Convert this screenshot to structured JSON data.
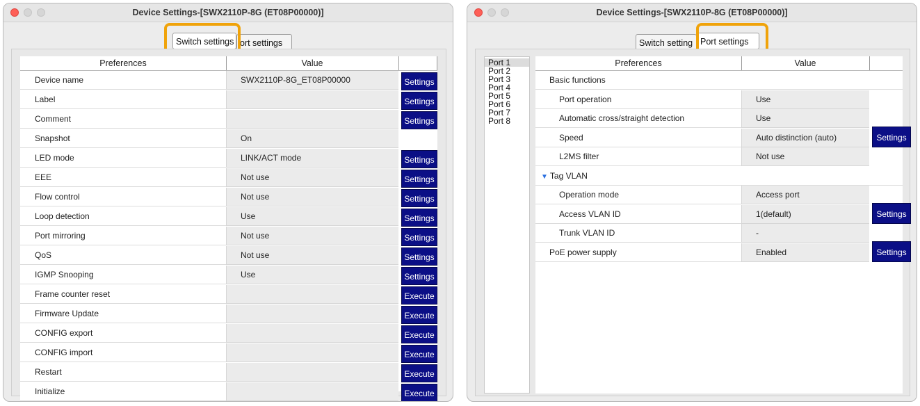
{
  "left_window": {
    "title": "Device Settings-[SWX2110P-8G (ET08P00000)]",
    "tabs": [
      "Switch settings",
      "ort settings"
    ],
    "headers": {
      "preferences": "Preferences",
      "value": "Value"
    },
    "rows": [
      {
        "pref": "Device name",
        "value": "SWX2110P-8G_ET08P00000",
        "button": "Settings"
      },
      {
        "pref": "Label",
        "value": "",
        "button": "Settings"
      },
      {
        "pref": "Comment",
        "value": "",
        "button": "Settings"
      },
      {
        "pref": "Snapshot",
        "value": "On",
        "button": ""
      },
      {
        "pref": "LED mode",
        "value": "LINK/ACT mode",
        "button": "Settings"
      },
      {
        "pref": "EEE",
        "value": "Not use",
        "button": "Settings"
      },
      {
        "pref": "Flow control",
        "value": "Not use",
        "button": "Settings"
      },
      {
        "pref": "Loop detection",
        "value": "Use",
        "button": "Settings"
      },
      {
        "pref": "Port mirroring",
        "value": "Not use",
        "button": "Settings"
      },
      {
        "pref": "QoS",
        "value": "Not use",
        "button": "Settings"
      },
      {
        "pref": "IGMP Snooping",
        "value": "Use",
        "button": "Settings"
      },
      {
        "pref": "Frame counter reset",
        "value": "",
        "button": "Execute"
      },
      {
        "pref": "Firmware Update",
        "value": "",
        "button": "Execute"
      },
      {
        "pref": "CONFIG export",
        "value": "",
        "button": "Execute"
      },
      {
        "pref": "CONFIG import",
        "value": "",
        "button": "Execute"
      },
      {
        "pref": "Restart",
        "value": "",
        "button": "Execute"
      },
      {
        "pref": "Initialize",
        "value": "",
        "button": "Execute"
      }
    ]
  },
  "right_window": {
    "title": "Device Settings-[SWX2110P-8G (ET08P00000)]",
    "tabs": [
      "Switch setting",
      "Port settings"
    ],
    "ports": [
      "Port 1",
      "Port 2",
      "Port 3",
      "Port 4",
      "Port 5",
      "Port 6",
      "Port 7",
      "Port 8"
    ],
    "headers": {
      "preferences": "Preferences",
      "value": "Value"
    },
    "rows": [
      {
        "pref": "Basic functions",
        "value": null,
        "indent": 1
      },
      {
        "pref": "Port operation",
        "value": "Use",
        "indent": 2
      },
      {
        "pref": "Automatic cross/straight detection",
        "value": "Use",
        "indent": 2
      },
      {
        "pref": "Speed",
        "value": "Auto distinction (auto)",
        "indent": 2
      },
      {
        "pref": "L2MS filter",
        "value": "Not use",
        "indent": 2
      },
      {
        "pref": "Tag VLAN",
        "value": null,
        "indent": 0,
        "expander": "▼"
      },
      {
        "pref": "Operation mode",
        "value": "Access port",
        "indent": 2
      },
      {
        "pref": "Access VLAN ID",
        "value": "1(default)",
        "indent": 2
      },
      {
        "pref": "Trunk VLAN ID",
        "value": "-",
        "indent": 2
      },
      {
        "pref": "PoE power supply",
        "value": "Enabled",
        "indent": 1
      }
    ],
    "buttons": [
      "Settings",
      "Settings",
      "Settings"
    ]
  },
  "colors": {
    "accent_highlight": "#f0a30a",
    "button_bg": "#0b0f86",
    "close_light": "#fe5f57"
  }
}
